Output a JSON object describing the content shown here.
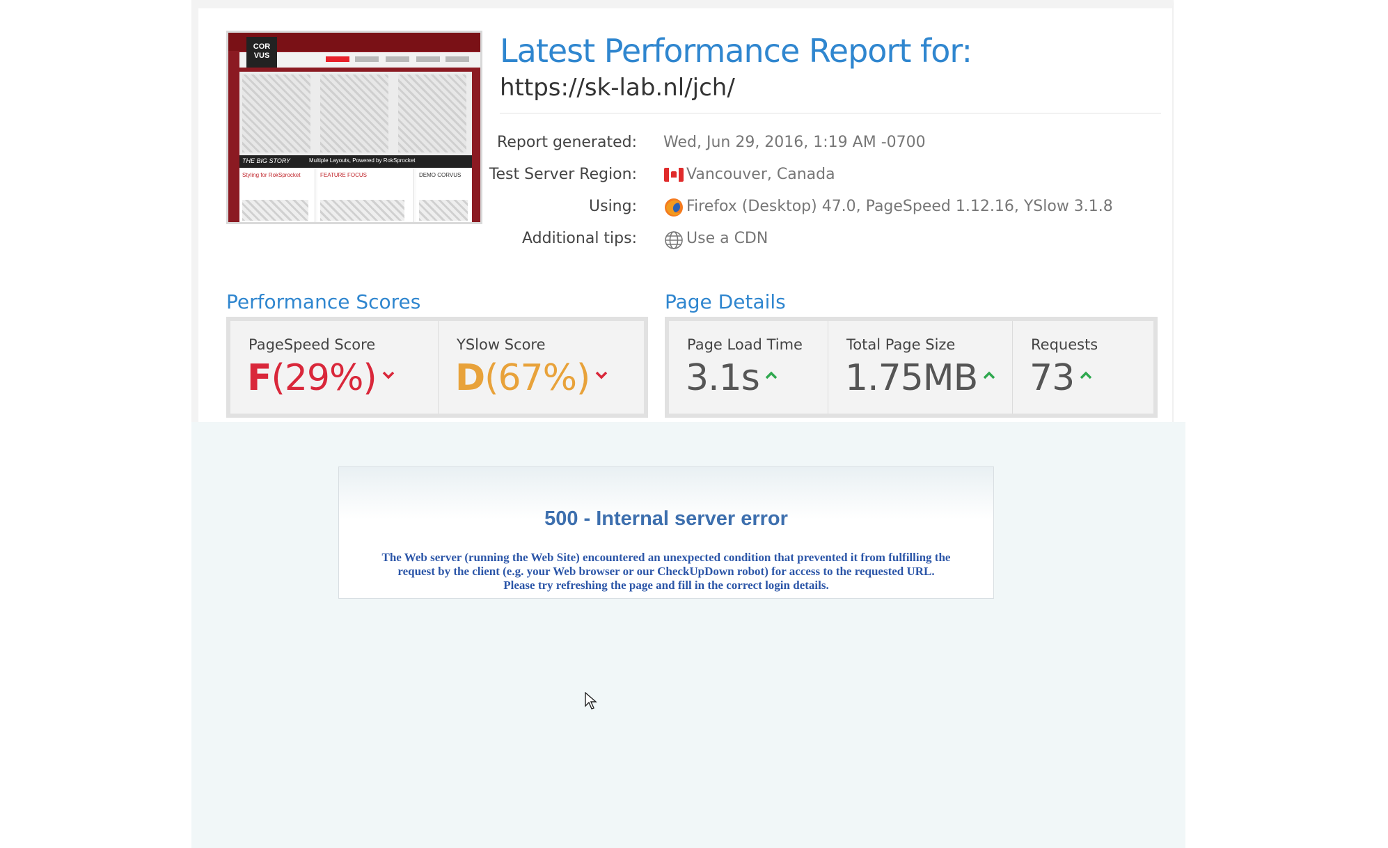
{
  "report": {
    "title": "Latest Performance Report for:",
    "url": "https://sk-lab.nl/jch/",
    "thumbnail": {
      "logo": "COR\nVUS",
      "banner_left": "THE BIG STORY",
      "banner_text": "Multiple Layouts, Powered by RokSprocket",
      "col1": "Styling for RokSprocket",
      "col2": "FEATURE FOCUS",
      "col3": "DEMO CORVUS"
    },
    "meta": [
      {
        "label": "Report generated:",
        "value": "Wed, Jun 29, 2016, 1:19 AM -0700",
        "icon": ""
      },
      {
        "label": "Test Server Region:",
        "value": "Vancouver, Canada",
        "icon": "canada-flag-icon"
      },
      {
        "label": "Using:",
        "value": "Firefox (Desktop) 47.0, PageSpeed 1.12.16, YSlow 3.1.8",
        "icon": "firefox-icon"
      },
      {
        "label": "Additional tips:",
        "value": "Use a CDN",
        "icon": "globe-icon"
      }
    ]
  },
  "performance": {
    "title": "Performance Scores",
    "pagespeed": {
      "label": "PageSpeed Score",
      "grade": "F",
      "percent": "(29%)",
      "trend": "down"
    },
    "yslow": {
      "label": "YSlow Score",
      "grade": "D",
      "percent": "(67%)",
      "trend": "down"
    }
  },
  "details": {
    "title": "Page Details",
    "load_time": {
      "label": "Page Load Time",
      "value": "3.1s",
      "trend": "up"
    },
    "page_size": {
      "label": "Total Page Size",
      "value": "1.75MB",
      "trend": "up"
    },
    "requests": {
      "label": "Requests",
      "value": "73",
      "trend": "up"
    }
  },
  "error": {
    "title": "500 - Internal server error",
    "message_line1": "The Web server (running the Web Site) encountered an unexpected condition that prevented it from fulfilling the",
    "message_line2": "request by the client (e.g. your Web browser or our CheckUpDown robot) for access to the requested URL.",
    "message_line3": "Please try refreshing the page and fill in the correct login details."
  },
  "colors": {
    "accent_blue": "#2f86cf",
    "grade_f": "#d9273a",
    "grade_d": "#e8a23a",
    "trend_up": "#2fa84f",
    "trend_down": "#d9273a",
    "error_title": "#3d6fae"
  }
}
